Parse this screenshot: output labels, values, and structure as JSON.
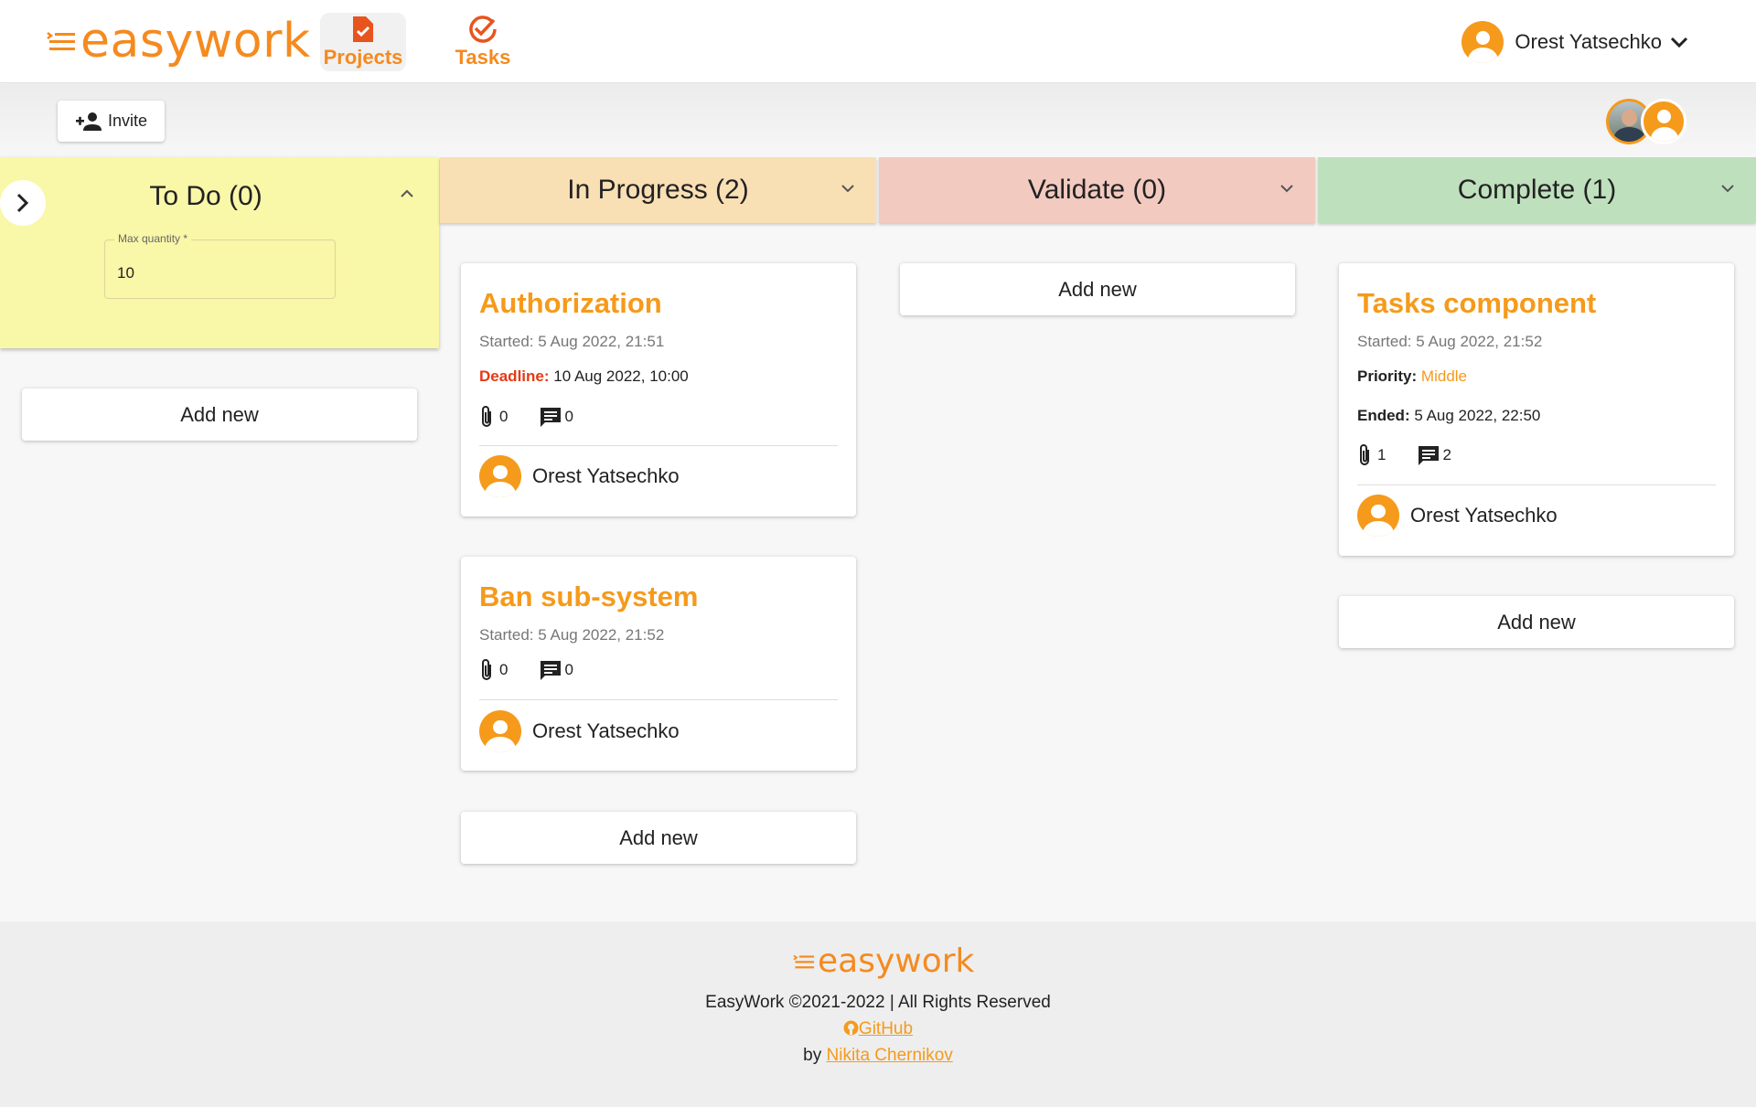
{
  "brand": {
    "name": "easywork",
    "color": "#f58a1f"
  },
  "nav": [
    {
      "label": "Projects",
      "icon": "project-document-icon",
      "active": true
    },
    {
      "label": "Tasks",
      "icon": "check-circle-icon",
      "active": false
    }
  ],
  "user": {
    "name": "Orest Yatsechko",
    "icon": "user-avatar-icon"
  },
  "toolbar": {
    "invite_label": "Invite",
    "invite_icon": "add-person-icon"
  },
  "members": [
    {
      "type": "photo",
      "icon": "member-photo"
    },
    {
      "type": "default",
      "icon": "user-avatar-icon"
    }
  ],
  "columns": {
    "todo": {
      "title": "To Do (0)",
      "color": "#f9f7a8",
      "max_quantity_label": "Max quantity *",
      "max_quantity": "10",
      "add_label": "Add new"
    },
    "in_progress": {
      "title": "In Progress (2)",
      "color": "#f9dfb4",
      "add_label": "Add new",
      "cards": [
        {
          "title": "Authorization",
          "started": "Started: 5 Aug 2022, 21:51",
          "deadline_key": "Deadline:",
          "deadline_value": "10 Aug 2022, 10:00",
          "attachments": "0",
          "comments": "0",
          "assignee": "Orest Yatsechko"
        },
        {
          "title": "Ban sub-system",
          "started": "Started: 5 Aug 2022, 21:52",
          "attachments": "0",
          "comments": "0",
          "assignee": "Orest Yatsechko"
        }
      ]
    },
    "validate": {
      "title": "Validate (0)",
      "color": "#f2cac0",
      "add_label": "Add new"
    },
    "complete": {
      "title": "Complete (1)",
      "color": "#bfe0bd",
      "add_label": "Add new",
      "cards": [
        {
          "title": "Tasks component",
          "started": "Started: 5 Aug 2022, 21:52",
          "priority_key": "Priority:",
          "priority_value": "Middle",
          "ended_key": "Ended:",
          "ended_value": "5 Aug 2022, 22:50",
          "attachments": "1",
          "comments": "2",
          "assignee": "Orest Yatsechko"
        }
      ]
    }
  },
  "footer": {
    "brand": "easywork",
    "copyright": "EasyWork ©2021-2022 | All Rights Reserved",
    "github_label": "GitHub",
    "github_icon": "github-icon",
    "by_prefix": "by",
    "author": "Nikita Chernikov"
  },
  "colors": {
    "accent": "#f59a1b",
    "deadline": "#e53a14"
  }
}
